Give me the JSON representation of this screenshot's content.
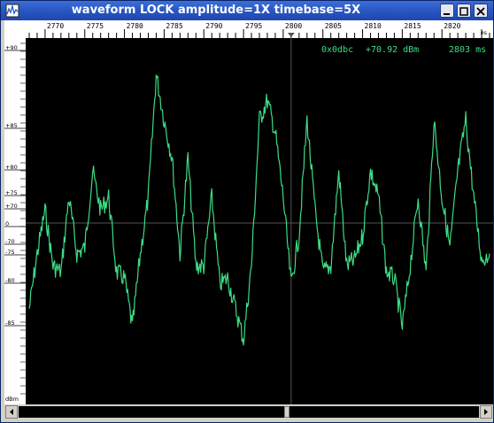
{
  "window": {
    "title": "waveform  LOCK amplitude=1X timebase=5X"
  },
  "time_ruler": {
    "labels": [
      "2770",
      "2775",
      "2780",
      "2785",
      "2790",
      "2795",
      "2800",
      "2805",
      "2810",
      "2815",
      "2820"
    ],
    "unit": "ms"
  },
  "level_ruler": {
    "labels": [
      "+90",
      "+85",
      "+80",
      "+75",
      "+70",
      "0",
      "-70",
      "-75",
      "-80",
      "-85"
    ],
    "unit": "dBm"
  },
  "readout": {
    "address": "0x0dbc",
    "level": "+70.92 dBm",
    "time": "2803 ms"
  },
  "colors": {
    "trace": "#3ddc84",
    "background": "#000000",
    "title_bar": "#2a58c4"
  },
  "chart_data": {
    "type": "line",
    "x_unit": "ms",
    "y_unit": "dBm",
    "xlim": [
      2768,
      2826
    ],
    "cursor_x": 2801,
    "x": [
      2768,
      2769,
      2770,
      2771,
      2772,
      2773,
      2774,
      2775,
      2776,
      2777,
      2778,
      2779,
      2780,
      2781,
      2782,
      2783,
      2784,
      2785,
      2786,
      2787,
      2788,
      2789,
      2790,
      2791,
      2792,
      2793,
      2794,
      2795,
      2796,
      2797,
      2798,
      2799,
      2800,
      2801,
      2802,
      2803,
      2804,
      2805,
      2806,
      2807,
      2808,
      2809,
      2810,
      2811,
      2812,
      2813,
      2814,
      2815,
      2816,
      2817,
      2818,
      2819,
      2820,
      2821,
      2822,
      2823,
      2824,
      2825,
      2826
    ],
    "series": [
      {
        "values": [
          -82,
          -73,
          70,
          -75,
          -76,
          72,
          -73,
          -72,
          76,
          70,
          72,
          -76,
          -77,
          -85,
          -73,
          72,
          91,
          84,
          78,
          -73,
          78,
          -75,
          -75,
          72,
          -78,
          -77,
          -82,
          -87,
          -75,
          84,
          87,
          82,
          72,
          -78,
          -70,
          84,
          70,
          -76,
          -75,
          76,
          -75,
          -74,
          -70,
          76,
          72,
          -76,
          -77,
          -85,
          -75,
          72,
          -76,
          84,
          72,
          -72,
          76,
          84,
          72,
          -74,
          -73
        ]
      }
    ]
  }
}
